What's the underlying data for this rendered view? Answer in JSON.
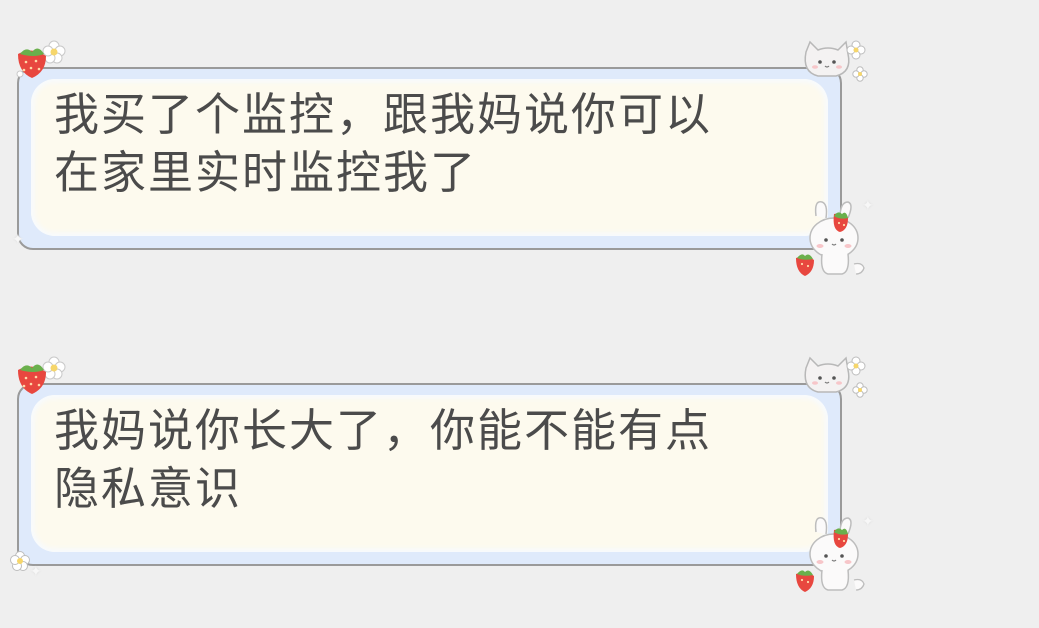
{
  "messages": [
    {
      "text": "我买了个监控，跟我妈说你可以\n在家里实时监控我了"
    },
    {
      "text": "我妈说你长大了，你能不能有点\n隐私意识"
    }
  ],
  "decorations": {
    "corner_top_left": "strawberry-flower-icon",
    "corner_top_right": "cat-sticker-icon",
    "corner_bottom_right": "bunny-strawberry-icon",
    "corner_bottom_left": "flower-icon"
  },
  "colors": {
    "background": "#efefef",
    "bubble_outline": "#9a9a9a",
    "bubble_frame": "#dfeafb",
    "bubble_fill": "#fdfaee",
    "text": "#4b4b4b",
    "strawberry": "#e8473f"
  }
}
